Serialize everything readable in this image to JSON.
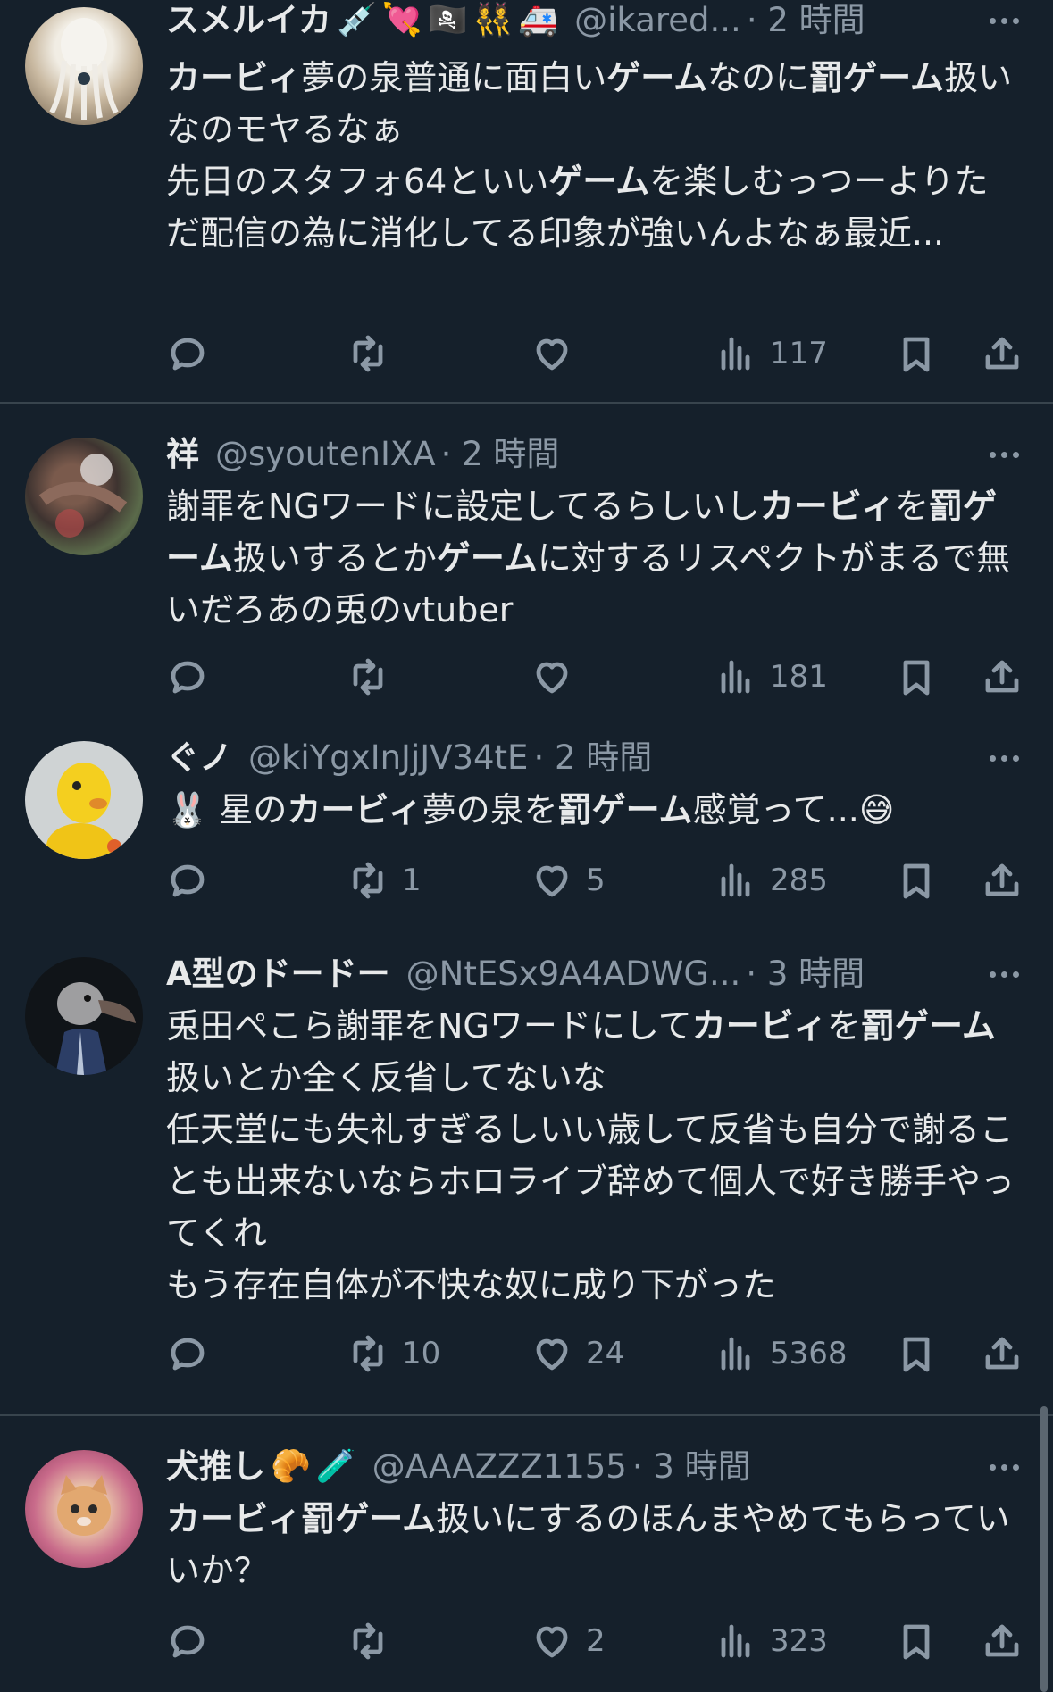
{
  "tweets": [
    {
      "name": "スメルイカ",
      "emojis": [
        "💉",
        "💘",
        "🏴‍☠️",
        "👯",
        "🚑"
      ],
      "handle": "@ikared...",
      "time": "· 2 時間",
      "segments": [
        {
          "t": "カービィ",
          "b": true
        },
        {
          "t": "夢の泉普通に面白い",
          "b": false
        },
        {
          "t": "ゲーム",
          "b": true
        },
        {
          "t": "なのに",
          "b": false
        },
        {
          "t": "罰ゲーム",
          "b": true
        },
        {
          "t": "扱いなのモヤるなぁ\n先日のスタフォ64といい",
          "b": false
        },
        {
          "t": "ゲーム",
          "b": true
        },
        {
          "t": "を楽しむっつーよりただ配信の為に消化してる印象が強いんよなぁ最近...",
          "b": false
        }
      ],
      "reply": "",
      "retweet": "",
      "like": "",
      "views": "117"
    },
    {
      "name": "祥",
      "emojis": [],
      "handle": "@syoutenIXA",
      "time": "· 2 時間",
      "segments": [
        {
          "t": "謝罪をNGワードに設定してるらしいし",
          "b": false
        },
        {
          "t": "カービィ",
          "b": true
        },
        {
          "t": "を",
          "b": false
        },
        {
          "t": "罰ゲーム",
          "b": true
        },
        {
          "t": "扱いするとか",
          "b": false
        },
        {
          "t": "ゲーム",
          "b": true
        },
        {
          "t": "に対するリスペクトがまるで無いだろあの兎のvtuber",
          "b": false
        }
      ],
      "reply": "",
      "retweet": "",
      "like": "",
      "views": "181"
    },
    {
      "name": "ぐノ",
      "emojis": [],
      "handle": "@kiYgxInJjJV34tE",
      "time": "· 2 時間",
      "segments": [
        {
          "t": "🐰 星の",
          "b": false
        },
        {
          "t": "カービィ",
          "b": true
        },
        {
          "t": "夢の泉を",
          "b": false
        },
        {
          "t": "罰ゲーム",
          "b": true
        },
        {
          "t": "感覚って...😅",
          "b": false
        }
      ],
      "reply": "",
      "retweet": "1",
      "like": "5",
      "views": "285"
    },
    {
      "name": "A型のドードー",
      "emojis": [],
      "handle": "@NtESx9A4ADWG...",
      "time": "· 3 時間",
      "segments": [
        {
          "t": "兎田ぺこら謝罪をNGワードにして",
          "b": false
        },
        {
          "t": "カービィ",
          "b": true
        },
        {
          "t": "を",
          "b": false
        },
        {
          "t": "罰ゲーム",
          "b": true
        },
        {
          "t": "扱いとか全く反省してないな\n任天堂にも失礼すぎるしいい歳して反省も自分で謝ることも出来ないならホロライブ辞めて個人で好き勝手やってくれ\nもう存在自体が不快な奴に成り下がった",
          "b": false
        }
      ],
      "reply": "",
      "retweet": "10",
      "like": "24",
      "views": "5368"
    },
    {
      "name": "犬推し",
      "emojis": [
        "🥐",
        "🧪"
      ],
      "handle": "@AAAZZZ1155",
      "time": "· 3 時間",
      "segments": [
        {
          "t": "カービィ罰ゲーム",
          "b": true
        },
        {
          "t": "扱いにするのほんまやめてもらっていいか？",
          "b": false
        }
      ],
      "reply": "",
      "retweet": "",
      "like": "2",
      "views": "323"
    }
  ],
  "colors": {
    "background": "#15202b",
    "text": "#e7e9ea",
    "secondary": "#8b98a5",
    "divider": "#38444d"
  }
}
